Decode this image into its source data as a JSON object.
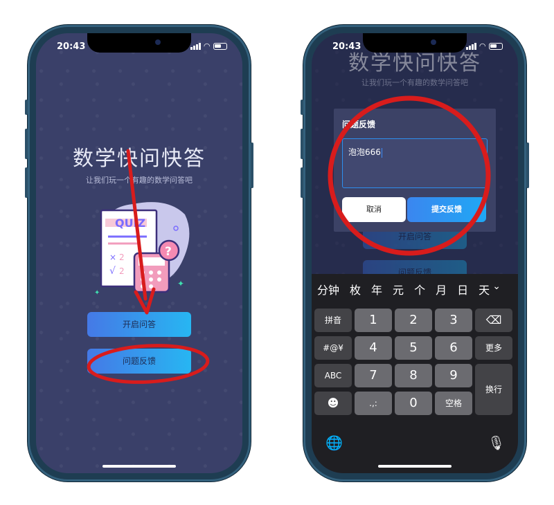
{
  "left": {
    "status_time": "20:43",
    "title": "数学快问快答",
    "subtitle": "让我们玩一个有趣的数学问答吧",
    "quiz_label": "QUIZ",
    "start_button": "开启问答",
    "feedback_button": "问题反馈"
  },
  "right": {
    "status_time": "20:43",
    "title": "数学快问快答",
    "subtitle": "让我们玩一个有趣的数学问答吧",
    "dialog": {
      "title": "问题反馈",
      "input_value": "泡泡666",
      "cancel": "取消",
      "submit": "提交反馈"
    },
    "background_start_button": "开启问答",
    "background_feedback_button": "问题反馈",
    "keyboard": {
      "candidates": [
        "分钟",
        "枚",
        "年",
        "元",
        "个",
        "月",
        "日",
        "天"
      ],
      "chevron": "⌄",
      "keys": {
        "pinyin": "拼音",
        "symbols": "#@¥",
        "abc": "ABC",
        "emoji": "☻",
        "k1": "1",
        "k2": "2",
        "k3": "3",
        "k4": "4",
        "k5": "5",
        "k6": "6",
        "k7": "7",
        "k8": "8",
        "k9": "9",
        "punct": ".,:",
        "k0": "0",
        "space": "空格",
        "backspace": "⌫",
        "more": "更多",
        "return": "换行"
      },
      "globe_icon": "🌐",
      "mic_icon": "🎙"
    }
  },
  "colors": {
    "screen_bg": "#3a4069",
    "button_gradient_start": "#4579e6",
    "button_gradient_end": "#27b6f2",
    "annotation_red": "#d81c1c",
    "phone_frame": "#1e3d52"
  }
}
